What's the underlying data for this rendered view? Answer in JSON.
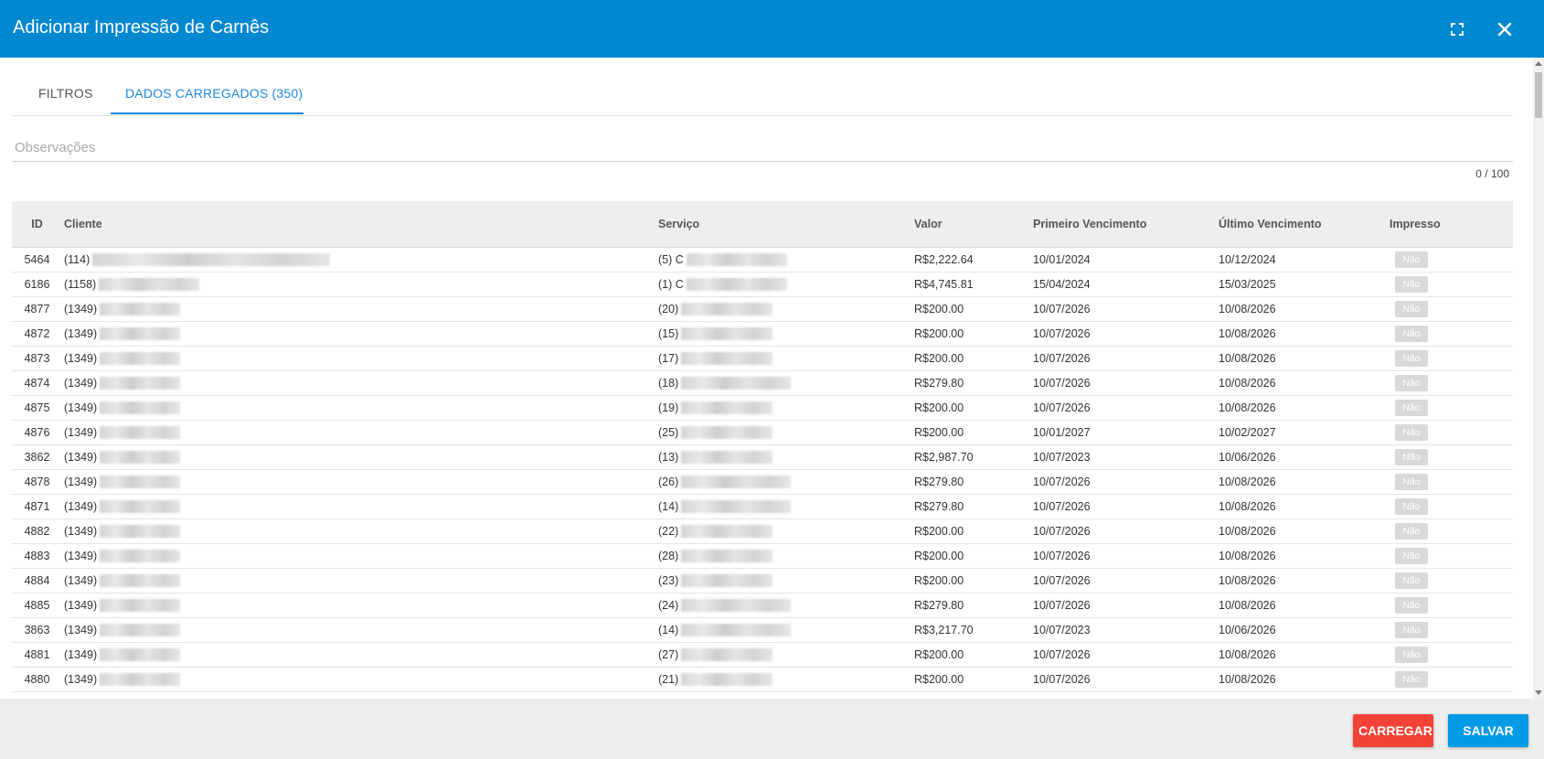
{
  "header": {
    "title": "Adicionar Impressão de Carnês",
    "fullscreen_icon": "fullscreen-icon",
    "close_icon": "close-icon"
  },
  "tabs": [
    {
      "label": "FILTROS",
      "active": false
    },
    {
      "label": "DADOS CARREGADOS (350)",
      "active": true
    }
  ],
  "observacoes": {
    "placeholder": "Observações",
    "value": "",
    "counter": "0 / 100"
  },
  "table": {
    "columns": [
      "ID",
      "Cliente",
      "Serviço",
      "Valor",
      "Primeiro Vencimento",
      "Último Vencimento",
      "Impresso"
    ],
    "rows": [
      {
        "id": "5464",
        "cliente": "(114)",
        "servico": "(5) C",
        "valor": "R$2,222.64",
        "primeiro": "10/01/2024",
        "ultimo": "10/12/2024",
        "impresso": "Não"
      },
      {
        "id": "6186",
        "cliente": "(1158)",
        "servico": "(1) C",
        "valor": "R$4,745.81",
        "primeiro": "15/04/2024",
        "ultimo": "15/03/2025",
        "impresso": "Não"
      },
      {
        "id": "4877",
        "cliente": "(1349)",
        "servico": "(20)",
        "valor": "R$200.00",
        "primeiro": "10/07/2026",
        "ultimo": "10/08/2026",
        "impresso": "Não"
      },
      {
        "id": "4872",
        "cliente": "(1349)",
        "servico": "(15)",
        "valor": "R$200.00",
        "primeiro": "10/07/2026",
        "ultimo": "10/08/2026",
        "impresso": "Não"
      },
      {
        "id": "4873",
        "cliente": "(1349)",
        "servico": "(17)",
        "valor": "R$200.00",
        "primeiro": "10/07/2026",
        "ultimo": "10/08/2026",
        "impresso": "Não"
      },
      {
        "id": "4874",
        "cliente": "(1349)",
        "servico": "(18)",
        "valor": "R$279.80",
        "primeiro": "10/07/2026",
        "ultimo": "10/08/2026",
        "impresso": "Não"
      },
      {
        "id": "4875",
        "cliente": "(1349)",
        "servico": "(19)",
        "valor": "R$200.00",
        "primeiro": "10/07/2026",
        "ultimo": "10/08/2026",
        "impresso": "Não"
      },
      {
        "id": "4876",
        "cliente": "(1349)",
        "servico": "(25)",
        "valor": "R$200.00",
        "primeiro": "10/01/2027",
        "ultimo": "10/02/2027",
        "impresso": "Não"
      },
      {
        "id": "3862",
        "cliente": "(1349)",
        "servico": "(13)",
        "valor": "R$2,987.70",
        "primeiro": "10/07/2023",
        "ultimo": "10/06/2026",
        "impresso": "Não"
      },
      {
        "id": "4878",
        "cliente": "(1349)",
        "servico": "(26)",
        "valor": "R$279.80",
        "primeiro": "10/07/2026",
        "ultimo": "10/08/2026",
        "impresso": "Não"
      },
      {
        "id": "4871",
        "cliente": "(1349)",
        "servico": "(14)",
        "valor": "R$279.80",
        "primeiro": "10/07/2026",
        "ultimo": "10/08/2026",
        "impresso": "Não"
      },
      {
        "id": "4882",
        "cliente": "(1349)",
        "servico": "(22)",
        "valor": "R$200.00",
        "primeiro": "10/07/2026",
        "ultimo": "10/08/2026",
        "impresso": "Não"
      },
      {
        "id": "4883",
        "cliente": "(1349)",
        "servico": "(28)",
        "valor": "R$200.00",
        "primeiro": "10/07/2026",
        "ultimo": "10/08/2026",
        "impresso": "Não"
      },
      {
        "id": "4884",
        "cliente": "(1349)",
        "servico": "(23)",
        "valor": "R$200.00",
        "primeiro": "10/07/2026",
        "ultimo": "10/08/2026",
        "impresso": "Não"
      },
      {
        "id": "4885",
        "cliente": "(1349)",
        "servico": "(24)",
        "valor": "R$279.80",
        "primeiro": "10/07/2026",
        "ultimo": "10/08/2026",
        "impresso": "Não"
      },
      {
        "id": "3863",
        "cliente": "(1349)",
        "servico": "(14)",
        "valor": "R$3,217.70",
        "primeiro": "10/07/2023",
        "ultimo": "10/06/2026",
        "impresso": "Não"
      },
      {
        "id": "4881",
        "cliente": "(1349)",
        "servico": "(27)",
        "valor": "R$200.00",
        "primeiro": "10/07/2026",
        "ultimo": "10/08/2026",
        "impresso": "Não"
      },
      {
        "id": "4880",
        "cliente": "(1349)",
        "servico": "(21)",
        "valor": "R$200.00",
        "primeiro": "10/07/2026",
        "ultimo": "10/08/2026",
        "impresso": "Não"
      }
    ]
  },
  "footer": {
    "carregar_label": "CARREGAR",
    "salvar_label": "SALVAR"
  },
  "colors": {
    "header": "#0288d1",
    "accent": "#1e88e5",
    "carregar": "#f44336",
    "salvar": "#039be5",
    "badge": "#d9d9d9"
  }
}
